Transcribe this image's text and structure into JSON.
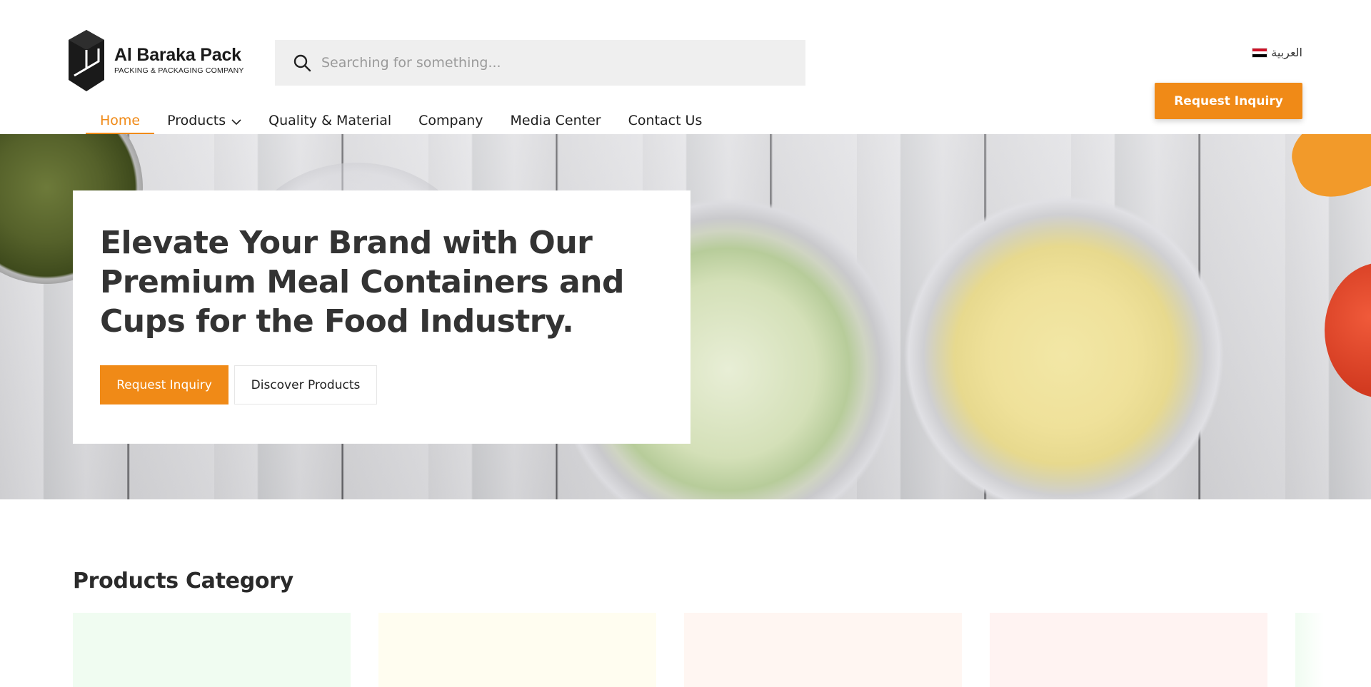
{
  "brand": {
    "name": "Al Baraka Pack",
    "tagline": "PACKING & PACKAGING COMPANY"
  },
  "search": {
    "placeholder": "Searching for something..."
  },
  "language": {
    "label": "العربية"
  },
  "header": {
    "inquiry_label": "Request Inquiry"
  },
  "nav": {
    "items": [
      {
        "label": "Home",
        "active": true
      },
      {
        "label": "Products",
        "has_dropdown": true
      },
      {
        "label": "Quality & Material"
      },
      {
        "label": "Company"
      },
      {
        "label": "Media Center"
      },
      {
        "label": "Contact Us"
      }
    ]
  },
  "hero": {
    "title": "Elevate Your Brand with Our Premium Meal Containers and Cups for the Food Industry.",
    "primary_label": "Request Inquiry",
    "secondary_label": "Discover Products"
  },
  "products_category": {
    "title": "Products Category"
  },
  "colors": {
    "accent": "#f08a17",
    "text_dark": "#333333",
    "search_bg": "#efefef"
  }
}
